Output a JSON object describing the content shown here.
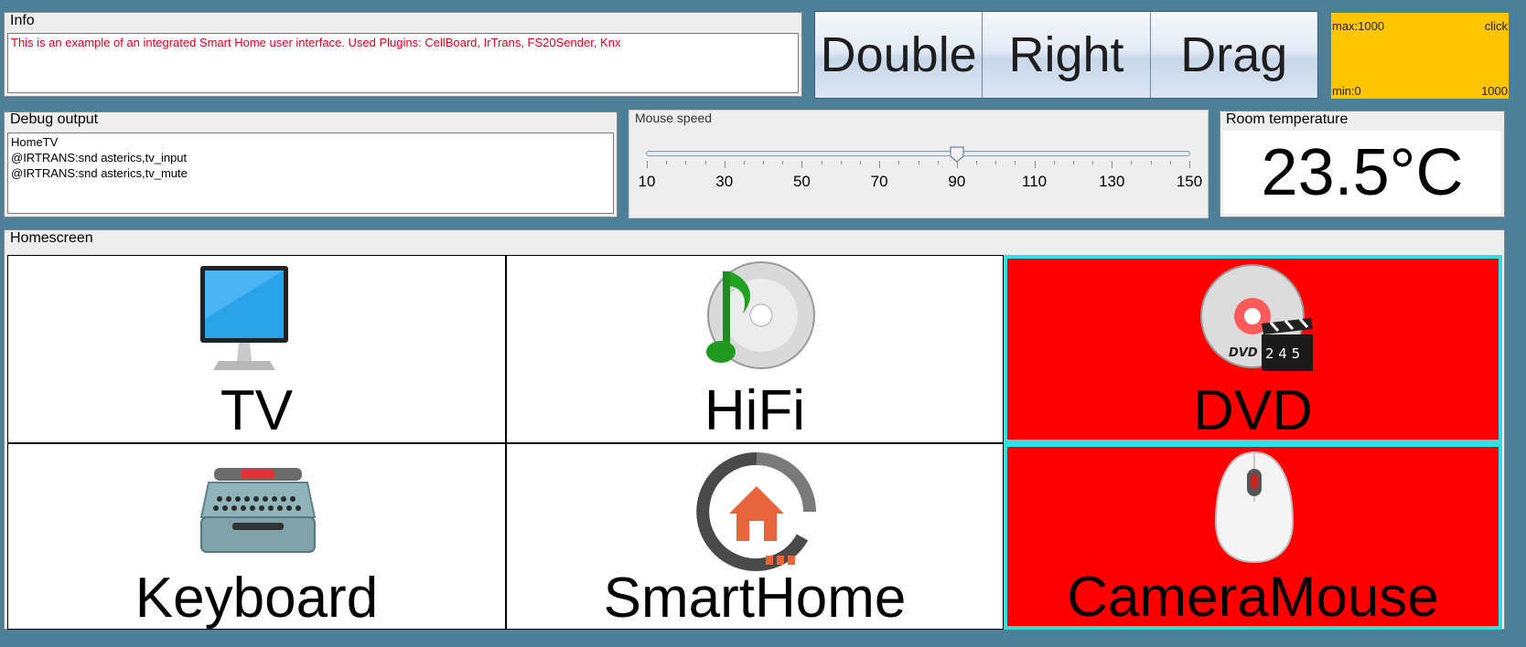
{
  "info": {
    "title": "Info",
    "text": "This is an example of an integrated Smart Home user interface.  Used Plugins: CellBoard, IrTrans, FS20Sender, Knx"
  },
  "mouse_buttons": [
    "Double",
    "Right",
    "Drag"
  ],
  "click_pad": {
    "max_label": "max:1000",
    "min_label": "min:0",
    "click_label": "click",
    "value_label": "1000",
    "color": "#ffc600"
  },
  "debug": {
    "title": "Debug output",
    "lines": [
      "HomeTV",
      "@IRTRANS:snd asterics,tv_input",
      "@IRTRANS:snd asterics,tv_mute"
    ]
  },
  "mouse_speed": {
    "title": "Mouse speed",
    "min": 10,
    "max": 150,
    "value": 90,
    "tick_labels": [
      "10",
      "30",
      "50",
      "70",
      "90",
      "110",
      "130",
      "150"
    ]
  },
  "room_temperature": {
    "title": "Room temperature",
    "value": "23.5°C"
  },
  "homescreen": {
    "title": "Homescreen",
    "cells": [
      {
        "label": "TV",
        "icon": "monitor-icon",
        "active": false
      },
      {
        "label": "HiFi",
        "icon": "music-cd-icon",
        "active": false
      },
      {
        "label": "DVD",
        "icon": "dvd-icon",
        "active": true
      },
      {
        "label": "Keyboard",
        "icon": "typewriter-icon",
        "active": false
      },
      {
        "label": "SmartHome",
        "icon": "smarthome-icon",
        "active": false
      },
      {
        "label": "CameraMouse",
        "icon": "mouse-icon",
        "active": true
      }
    ],
    "active_color": "#ff0000",
    "active_border_color": "#2fe0e0"
  }
}
